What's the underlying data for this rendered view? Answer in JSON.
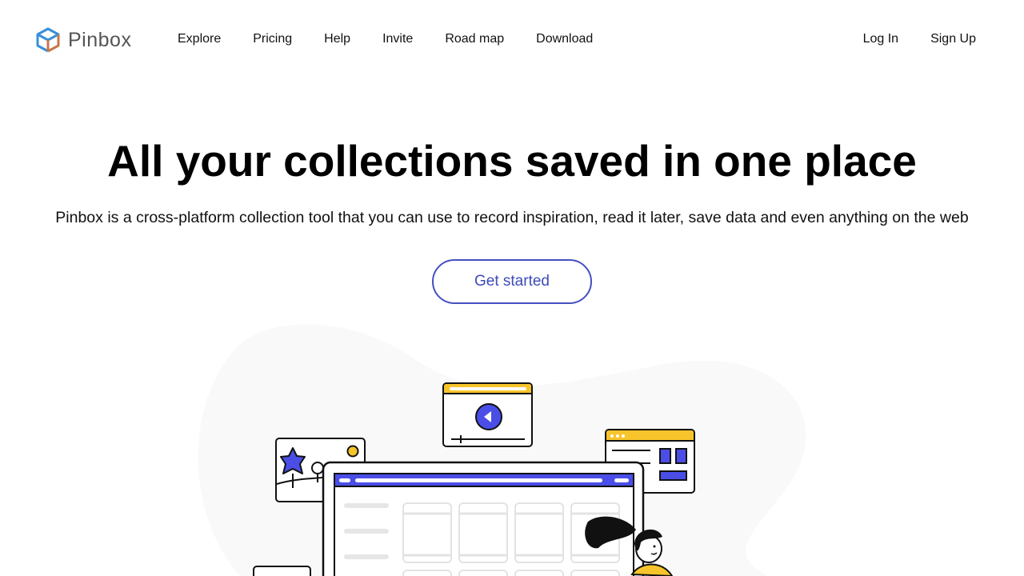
{
  "brand": {
    "name": "Pinbox",
    "icon": "cube-logo-icon"
  },
  "nav": {
    "items": [
      {
        "label": "Explore"
      },
      {
        "label": "Pricing"
      },
      {
        "label": "Help"
      },
      {
        "label": "Invite"
      },
      {
        "label": "Road map"
      },
      {
        "label": "Download"
      }
    ]
  },
  "auth": {
    "login": "Log In",
    "signup": "Sign Up"
  },
  "hero": {
    "title": "All your collections saved in one place",
    "subtitle": "Pinbox is a cross-platform collection tool that you can use to record inspiration, read it later, save data and even anything on the web",
    "cta": "Get started"
  },
  "colors": {
    "accent": "#4450c0",
    "illustration_blue": "#4a4ee6",
    "illustration_yellow": "#f7c52b",
    "blob": "#f9f9f9"
  }
}
